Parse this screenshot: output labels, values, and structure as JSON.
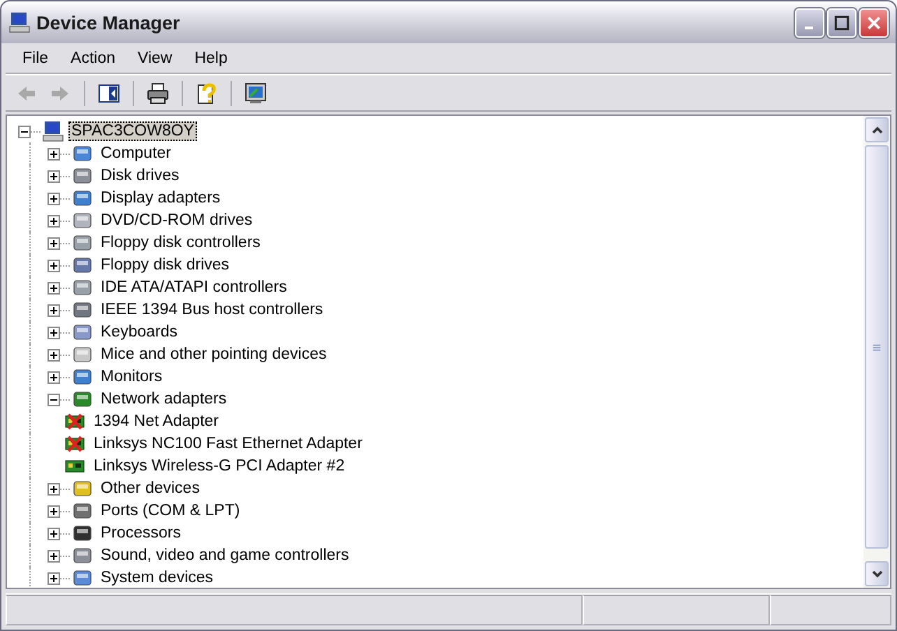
{
  "window": {
    "title": "Device Manager"
  },
  "menu": [
    "File",
    "Action",
    "View",
    "Help"
  ],
  "tree": {
    "label": "SPAC3COW8OY",
    "expanded": true,
    "selected": true,
    "children": [
      {
        "label": "Computer",
        "expanded": false
      },
      {
        "label": "Disk drives",
        "expanded": false
      },
      {
        "label": "Display adapters",
        "expanded": false
      },
      {
        "label": "DVD/CD-ROM drives",
        "expanded": false
      },
      {
        "label": "Floppy disk controllers",
        "expanded": false
      },
      {
        "label": "Floppy disk drives",
        "expanded": false
      },
      {
        "label": "IDE ATA/ATAPI controllers",
        "expanded": false
      },
      {
        "label": "IEEE 1394 Bus host controllers",
        "expanded": false
      },
      {
        "label": "Keyboards",
        "expanded": false
      },
      {
        "label": "Mice and other pointing devices",
        "expanded": false
      },
      {
        "label": "Monitors",
        "expanded": false
      },
      {
        "label": "Network adapters",
        "expanded": true,
        "children": [
          {
            "label": "1394 Net Adapter",
            "disabled": true
          },
          {
            "label": "Linksys NC100 Fast Ethernet Adapter",
            "disabled": true
          },
          {
            "label": "Linksys Wireless-G PCI Adapter #2",
            "disabled": false
          }
        ]
      },
      {
        "label": "Other devices",
        "expanded": false
      },
      {
        "label": "Ports (COM & LPT)",
        "expanded": false
      },
      {
        "label": "Processors",
        "expanded": false
      },
      {
        "label": "Sound, video and game controllers",
        "expanded": false
      },
      {
        "label": "System devices",
        "expanded": false
      }
    ]
  }
}
